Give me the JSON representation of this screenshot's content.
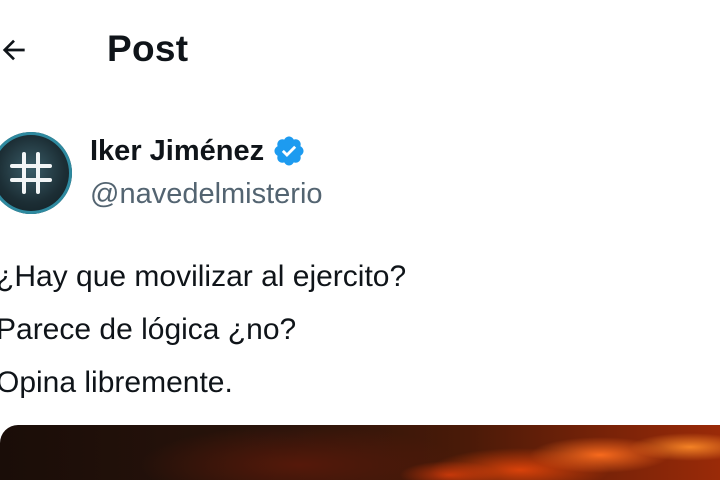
{
  "header": {
    "title": "Post",
    "back_icon": "arrow-left-icon"
  },
  "post": {
    "author": {
      "display_name": "Iker Jiménez",
      "handle": "@navedelmisterio",
      "verified": true,
      "avatar_icon": "hashtag-icon",
      "verified_color": "#1d9bf0"
    },
    "text_lines": [
      "¿Hay que movilizar al ejercito?",
      "Parece de lógica ¿no?",
      "Opina libremente."
    ],
    "media": {
      "description_color_accent": "#ff6a1a"
    }
  },
  "colors": {
    "text_primary": "#0f1419",
    "text_secondary": "#536471",
    "verified_badge": "#1d9bf0"
  }
}
